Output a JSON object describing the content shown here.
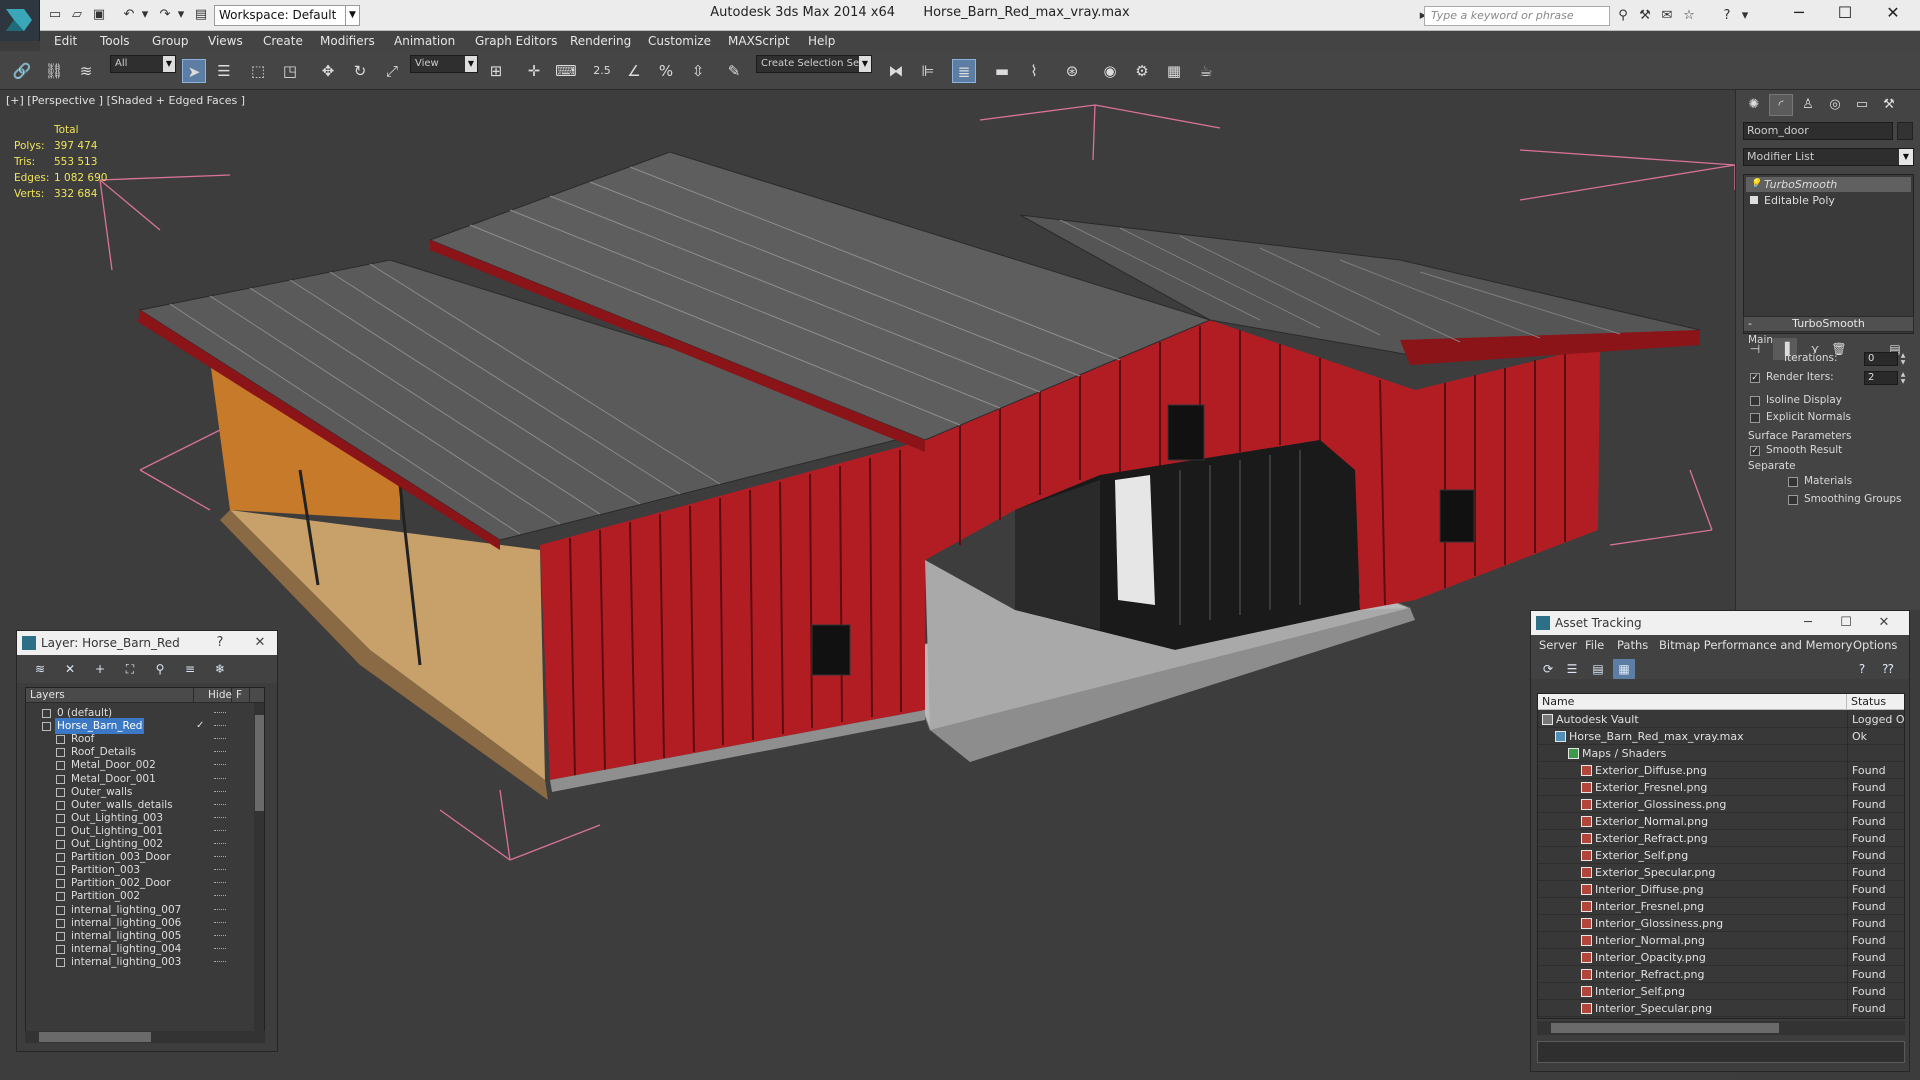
{
  "titlebar": {
    "workspace": "Workspace: Default",
    "app_name": "Autodesk 3ds Max  2014 x64",
    "file_name": "Horse_Barn_Red_max_vray.max",
    "search_placeholder": "Type a keyword or phrase"
  },
  "menu": [
    "Edit",
    "Tools",
    "Group",
    "Views",
    "Create",
    "Modifiers",
    "Animation",
    "Graph Editors",
    "Rendering",
    "Customize",
    "MAXScript",
    "Help"
  ],
  "toolbar": {
    "selection_filter": "All",
    "ref_coord": "View",
    "named_selection": "Create Selection Se",
    "snap_label": "2.5"
  },
  "viewport": {
    "label": "[+] [Perspective ] [Shaded + Edged Faces ]",
    "stats": {
      "header": "Total",
      "rows": [
        {
          "label": "Polys:",
          "value": "397 474"
        },
        {
          "label": "Tris:",
          "value": "553 513"
        },
        {
          "label": "Edges:",
          "value": "1 082 690"
        },
        {
          "label": "Verts:",
          "value": "332 684"
        }
      ]
    }
  },
  "command_panel": {
    "object_name": "Room_door",
    "modifier_list": "Modifier List",
    "stack": [
      "TurboSmooth",
      "Editable Poly"
    ],
    "rollout_title": "TurboSmooth",
    "main_group": "Main",
    "iterations_label": "Iterations:",
    "iterations_value": "0",
    "render_iters_label": "Render Iters:",
    "render_iters_value": "2",
    "render_iters_checked": true,
    "isoline_label": "Isoline Display",
    "explicit_normals_label": "Explicit Normals",
    "surface_group": "Surface Parameters",
    "smooth_result_label": "Smooth Result",
    "separate_label": "Separate",
    "materials_label": "Materials",
    "smoothing_groups_label": "Smoothing Groups"
  },
  "layer_panel": {
    "title": "Layer: Horse_Barn_Red",
    "help": "?",
    "col_layers": "Layers",
    "col_hide": "Hide",
    "col_f": "F",
    "layers": [
      {
        "name": "0 (default)",
        "indent": 0
      },
      {
        "name": "Horse_Barn_Red",
        "indent": 0,
        "selected": true
      },
      {
        "name": "Roof",
        "indent": 1
      },
      {
        "name": "Roof_Details",
        "indent": 1
      },
      {
        "name": "Metal_Door_002",
        "indent": 1
      },
      {
        "name": "Metal_Door_001",
        "indent": 1
      },
      {
        "name": "Outer_walls",
        "indent": 1
      },
      {
        "name": "Outer_walls_details",
        "indent": 1
      },
      {
        "name": "Out_Lighting_003",
        "indent": 1
      },
      {
        "name": "Out_Lighting_001",
        "indent": 1
      },
      {
        "name": "Out_Lighting_002",
        "indent": 1
      },
      {
        "name": "Partition_003_Door",
        "indent": 1
      },
      {
        "name": "Partition_003",
        "indent": 1
      },
      {
        "name": "Partition_002_Door",
        "indent": 1
      },
      {
        "name": "Partition_002",
        "indent": 1
      },
      {
        "name": "internal_lighting_007",
        "indent": 1
      },
      {
        "name": "internal_lighting_006",
        "indent": 1
      },
      {
        "name": "internal_lighting_005",
        "indent": 1
      },
      {
        "name": "internal_lighting_004",
        "indent": 1
      },
      {
        "name": "internal_lighting_003",
        "indent": 1
      }
    ]
  },
  "asset_panel": {
    "title": "Asset Tracking",
    "menu": [
      "Server",
      "File",
      "Paths",
      "Bitmap Performance and Memory",
      "Options"
    ],
    "col_name": "Name",
    "col_status": "Status",
    "rows": [
      {
        "name": "Autodesk Vault",
        "status": "Logged Out",
        "level": 0,
        "kind": "vault"
      },
      {
        "name": "Horse_Barn_Red_max_vray.max",
        "status": "Ok",
        "level": 1,
        "kind": "max"
      },
      {
        "name": "Maps / Shaders",
        "status": "",
        "level": 2,
        "kind": "folder"
      },
      {
        "name": "Exterior_Diffuse.png",
        "status": "Found",
        "level": 3,
        "kind": "file"
      },
      {
        "name": "Exterior_Fresnel.png",
        "status": "Found",
        "level": 3,
        "kind": "file"
      },
      {
        "name": "Exterior_Glossiness.png",
        "status": "Found",
        "level": 3,
        "kind": "file"
      },
      {
        "name": "Exterior_Normal.png",
        "status": "Found",
        "level": 3,
        "kind": "file"
      },
      {
        "name": "Exterior_Refract.png",
        "status": "Found",
        "level": 3,
        "kind": "file"
      },
      {
        "name": "Exterior_Self.png",
        "status": "Found",
        "level": 3,
        "kind": "file"
      },
      {
        "name": "Exterior_Specular.png",
        "status": "Found",
        "level": 3,
        "kind": "file"
      },
      {
        "name": "Interior_Diffuse.png",
        "status": "Found",
        "level": 3,
        "kind": "file"
      },
      {
        "name": "Interior_Fresnel.png",
        "status": "Found",
        "level": 3,
        "kind": "file"
      },
      {
        "name": "Interior_Glossiness.png",
        "status": "Found",
        "level": 3,
        "kind": "file"
      },
      {
        "name": "Interior_Normal.png",
        "status": "Found",
        "level": 3,
        "kind": "file"
      },
      {
        "name": "Interior_Opacity.png",
        "status": "Found",
        "level": 3,
        "kind": "file"
      },
      {
        "name": "Interior_Refract.png",
        "status": "Found",
        "level": 3,
        "kind": "file"
      },
      {
        "name": "Interior_Self.png",
        "status": "Found",
        "level": 3,
        "kind": "file"
      },
      {
        "name": "Interior_Specular.png",
        "status": "Found",
        "level": 3,
        "kind": "file"
      }
    ]
  },
  "colors": {
    "accent": "#5d7ea4",
    "selection": "#3b78c5",
    "stats": "#f0e45a",
    "barn_red": "#b21d24",
    "bounding_box": "#d9729a"
  }
}
